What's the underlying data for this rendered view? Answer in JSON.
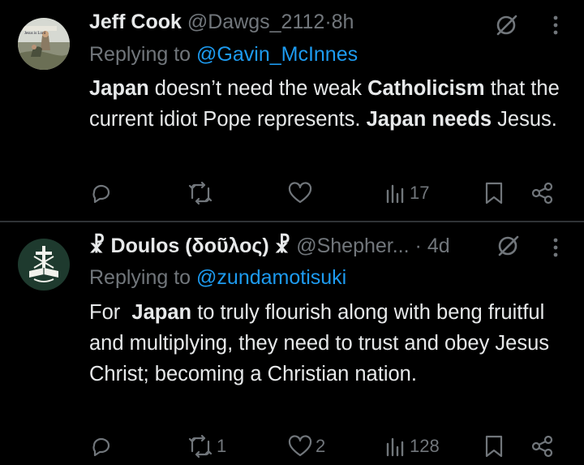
{
  "posts": [
    {
      "display_name": "Jeff Cook",
      "handle": "@Dawgs_2112",
      "separator": "·",
      "time": "8h",
      "replying_to_label": "Replying to",
      "replying_to_user": "@Gavin_McInnes",
      "avatar_icon": "jesus-in-lord-painting-avatar",
      "avatar_caption": "Jesus is Lord",
      "text_segments": [
        {
          "t": "Japan",
          "bold": true
        },
        {
          "t": " doesn’t need the weak ",
          "bold": false
        },
        {
          "t": "Catholicism",
          "bold": true
        },
        {
          "t": " that the current idiot Pope represents. ",
          "bold": false
        },
        {
          "t": "Japan needs",
          "bold": true
        },
        {
          "t": " Jesus.",
          "bold": false
        }
      ],
      "actions": {
        "reply_count": "",
        "repost_count": "",
        "like_count": "",
        "views_count": "17"
      }
    },
    {
      "display_name_prefix": "☧",
      "display_name": "Doulos (δοῦλος)",
      "display_name_suffix": "☧",
      "handle": "@Shepher...",
      "separator": "·",
      "time": "4d",
      "replying_to_label": "Replying to",
      "replying_to_user": "@zundamotisuki",
      "avatar_icon": "cross-and-bible-emblem-avatar",
      "text_segments": [
        {
          "t": "For  ",
          "bold": false
        },
        {
          "t": "Japan",
          "bold": true
        },
        {
          "t": " to truly flourish along with beng fruitful and multiplying, they need to trust and obey Jesus Christ; becoming a Christian nation.",
          "bold": false
        }
      ],
      "actions": {
        "reply_count": "",
        "repost_count": "1",
        "like_count": "2",
        "views_count": "128"
      }
    }
  ],
  "colors": {
    "background": "#000000",
    "text": "#e7e9ea",
    "muted": "#71767b",
    "link": "#1d9bf0",
    "divider": "#2f3336",
    "avatar2_bg": "#1e3a2e"
  },
  "icons": [
    "reply-icon",
    "repost-icon",
    "like-icon",
    "views-icon",
    "bookmark-icon",
    "share-icon",
    "grok-icon",
    "more-options-icon"
  ]
}
